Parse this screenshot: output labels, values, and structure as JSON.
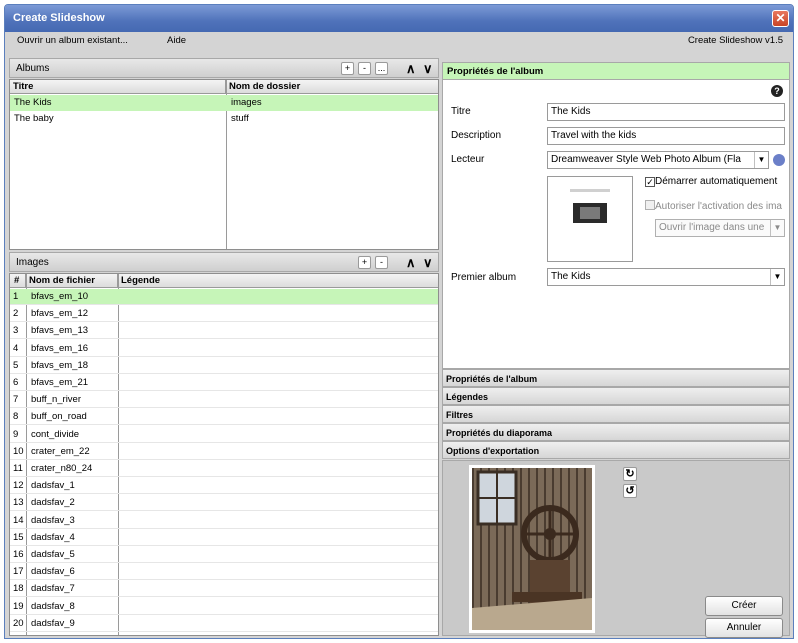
{
  "window": {
    "title": "Create Slideshow",
    "close_symbol": "✕"
  },
  "menu": {
    "open_album": "Ouvrir un album existant...",
    "help": "Aide",
    "version": "Create Slideshow v1.5"
  },
  "albums": {
    "header": "Albums",
    "buttons": [
      "+",
      "-",
      "...",
      "∧",
      "∨"
    ],
    "columns": [
      "Titre",
      "Nom de dossier"
    ],
    "rows": [
      {
        "title": "The Kids",
        "folder": "images",
        "selected": true
      },
      {
        "title": "The baby",
        "folder": "stuff",
        "selected": false
      }
    ]
  },
  "images": {
    "header": "Images",
    "buttons": [
      "+",
      "-",
      "∧",
      "∨"
    ],
    "columns": [
      "#",
      "Nom de fichier",
      "Légende"
    ],
    "rows": [
      {
        "n": "1",
        "file": "bfavs_em_10",
        "caption": ""
      },
      {
        "n": "2",
        "file": "bfavs_em_12",
        "caption": ""
      },
      {
        "n": "3",
        "file": "bfavs_em_13",
        "caption": ""
      },
      {
        "n": "4",
        "file": "bfavs_em_16",
        "caption": ""
      },
      {
        "n": "5",
        "file": "bfavs_em_18",
        "caption": ""
      },
      {
        "n": "6",
        "file": "bfavs_em_21",
        "caption": ""
      },
      {
        "n": "7",
        "file": "buff_n_river",
        "caption": ""
      },
      {
        "n": "8",
        "file": "buff_on_road",
        "caption": ""
      },
      {
        "n": "9",
        "file": "cont_divide",
        "caption": ""
      },
      {
        "n": "10",
        "file": "crater_em_22",
        "caption": ""
      },
      {
        "n": "11",
        "file": "crater_n80_24",
        "caption": ""
      },
      {
        "n": "12",
        "file": "dadsfav_1",
        "caption": ""
      },
      {
        "n": "13",
        "file": "dadsfav_2",
        "caption": ""
      },
      {
        "n": "14",
        "file": "dadsfav_3",
        "caption": ""
      },
      {
        "n": "15",
        "file": "dadsfav_4",
        "caption": ""
      },
      {
        "n": "16",
        "file": "dadsfav_5",
        "caption": ""
      },
      {
        "n": "17",
        "file": "dadsfav_6",
        "caption": ""
      },
      {
        "n": "18",
        "file": "dadsfav_7",
        "caption": ""
      },
      {
        "n": "19",
        "file": "dadsfav_8",
        "caption": ""
      },
      {
        "n": "20",
        "file": "dadsfav_9",
        "caption": ""
      }
    ]
  },
  "props": {
    "header": "Propriétés de l'album",
    "help_symbol": "?",
    "title_label": "Titre",
    "title_value": "The Kids",
    "desc_label": "Description",
    "desc_value": "Travel with the kids",
    "player_label": "Lecteur",
    "player_value": "Dreamweaver Style Web Photo Album (Fla",
    "autostart_label": "Démarrer automatiquement",
    "allow_label": "Autoriser l'activation des ima",
    "open_image_value": "Ouvrir l'image dans une",
    "first_album_label": "Premier album",
    "first_album_value": "The Kids"
  },
  "accordion": [
    "Propriétés de l'album",
    "Légendes",
    "Filtres",
    "Propriétés du diaporama",
    "Options d'exportation"
  ],
  "actions": {
    "create": "Créer",
    "cancel": "Annuler"
  },
  "colors": {
    "selection": "#c6f5b8",
    "titlebar": "#4f72ba"
  }
}
